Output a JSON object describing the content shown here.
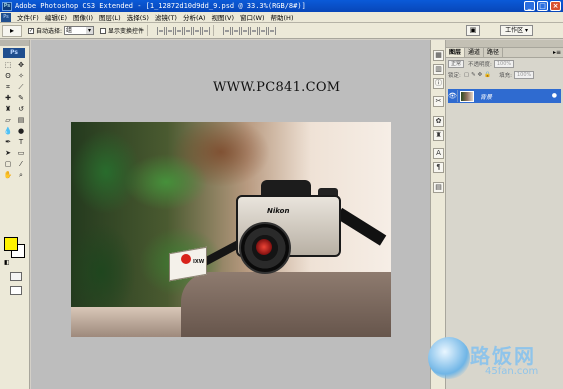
{
  "window": {
    "title": "Adobe Photoshop CS3 Extended - [1_12872d10d9dd_9.psd @ 33.3%(RGB/8#)]",
    "ps_badge": "Ps"
  },
  "menu": [
    "文件(F)",
    "编辑(E)",
    "图像(I)",
    "图层(L)",
    "选择(S)",
    "滤镜(T)",
    "分析(A)",
    "视图(V)",
    "窗口(W)",
    "帮助(H)"
  ],
  "options": {
    "tool_glyph": "▸",
    "auto_select_label": "自动选择:",
    "auto_select_value": "组",
    "show_transform_label": "显示变换控件",
    "workspace_label": "工作区 ▾"
  },
  "canvas": {
    "watermark_url": "WWW.PC841.COM",
    "nikon_label": "Nikon",
    "film_box_label": "IXW"
  },
  "panel": {
    "tabs": [
      "图层",
      "通道",
      "路径"
    ],
    "blend_mode": "正常",
    "opacity_label": "不透明度:",
    "opacity_value": "100%",
    "lock_label": "锁定:",
    "fill_label": "填充:",
    "fill_value": "100%",
    "layer_name": "背景"
  },
  "brand": {
    "name": "路饭网",
    "domain": "45fan.com"
  },
  "colors": {
    "foreground": "#fff200",
    "background": "#ffffff",
    "title_bar": "#0a5ad8",
    "selected_layer": "#2f6bd0"
  }
}
